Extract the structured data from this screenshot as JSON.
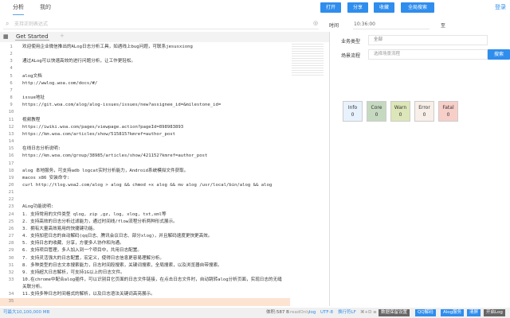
{
  "tabs": [
    "分析",
    "我的"
  ],
  "toolbar": {
    "open": "打开",
    "share": "分享",
    "favorite": "收藏",
    "global_search": "全局搜索",
    "login": "登录"
  },
  "search": {
    "placeholder": "支持正则表达式",
    "time_label": "时间",
    "time_value": "10:36:00",
    "to_label": "至"
  },
  "editor": {
    "tab": "Get Started",
    "add": "+",
    "lines": [
      [
        "1",
        "欢迎使用企业微信推出的ALog日志分析工具，如遇线上bug问题，可联系jesusxiong"
      ],
      [
        "2",
        ""
      ],
      [
        "3",
        "通过ALog可以快速高效的进行问题分析，让工作更轻松。"
      ],
      [
        "4",
        ""
      ],
      [
        "5",
        "alog文档"
      ],
      [
        "6",
        "http://wwlog.woa.com/docs/#/"
      ],
      [
        "7",
        ""
      ],
      [
        "8",
        "issue地址"
      ],
      [
        "9",
        "https://git.woa.com/alog/alog-issues/issues/new?assignee_id=&milestone_id="
      ],
      [
        "10",
        ""
      ],
      [
        "11",
        "视频教程"
      ],
      [
        "12",
        "https://iwiki.woa.com/pages/viewpage.action?pageId=898983893"
      ],
      [
        "13",
        "https://km.woa.com/articles/show/515815?kmref=author_post"
      ],
      [
        "14",
        ""
      ],
      [
        "15",
        "在线日志分析说明:"
      ],
      [
        "16",
        "https://km.woa.com/group/38985/articles/show/421152?kmref=author_post"
      ],
      [
        "17",
        ""
      ],
      [
        "18",
        "alog 本地服务，可支持adb logcat实时分析能力，Android系统模拟文件获取。"
      ],
      [
        "19",
        "macos x86 安装命令:"
      ],
      [
        "20",
        "curl http://tlog.woa2.com/alog > alog && chmod +x alog && mv alog /usr/local/bin/alog && alog"
      ],
      [
        "21",
        ""
      ],
      [
        "22",
        ""
      ],
      [
        "23",
        "ALog功能说明:"
      ],
      [
        "24",
        "1. 支持常用的文件类型  qlog, zip ,gz, log, xlog, txt,xml等"
      ],
      [
        "25",
        "2. 支持高效的日志分析过滤能力，通过时间线/flow流程分析两种形式展示。"
      ],
      [
        "26",
        "3. 拥有大量高效易用的快捷键功能。"
      ],
      [
        "27",
        "4. 支持加密日志的自动解码(qq日志、腾讯会议日志、部分xlog)，并且解码速度更快更高效。"
      ],
      [
        "28",
        "5. 支持日志的收藏、分享，方便多人协作和沟通。"
      ],
      [
        "29",
        "6. 支持项目管理，多人加入到一个项目中，共用日志配置。"
      ],
      [
        "30",
        "7. 支持灵活强大的日志配置，宏定义，使得日志信息更容易理解分析。"
      ],
      [
        "31",
        "8. 多种类型的日志文本搜索能力，日志时间段搜索，关键词搜索，全局搜索，以及浏览器自带搜索。"
      ],
      [
        "32",
        "9. 支持超大日志解析，可支持1G以上的日志文件。"
      ],
      [
        "33",
        "10.在chrome中配合alog插件，可以识别目它页面的日志文件链接，在点击日志文件时，自动跳转alog分析页面，实现日志的无缝关联分析。"
      ],
      [
        "34",
        "11.支持多种日志时间格式的解析，以及日志语法关键词高亮展示。"
      ],
      [
        "35",
        ""
      ]
    ]
  },
  "filters": {
    "biz_label": "业务类型",
    "biz_value": "全部",
    "scene_label": "场景流程",
    "scene_placeholder": "选择场景流程",
    "search_button": "搜索"
  },
  "levels": [
    {
      "name": "Info",
      "count": "0",
      "color": "#e8f2fc"
    },
    {
      "name": "Core",
      "count": "0",
      "color": "#c5d9c0"
    },
    {
      "name": "Warn",
      "count": "0",
      "color": "#dde6b8"
    },
    {
      "name": "Error",
      "count": "0",
      "color": "#f7efe8"
    },
    {
      "name": "Fatal",
      "count": "0",
      "color": "#f7cfc8"
    }
  ],
  "status": {
    "left": "可最大10,100,000 MB",
    "size": "体积:587 B",
    "readonly": "readOnly",
    "lang": "log",
    "encoding": "UTF-8",
    "eol": "换行符LF",
    "shortcut": "⌘+D ≡",
    "buttons": [
      "数据保留设置",
      "QQ解码",
      "Alog服务",
      "清屏",
      "开启Log"
    ]
  }
}
